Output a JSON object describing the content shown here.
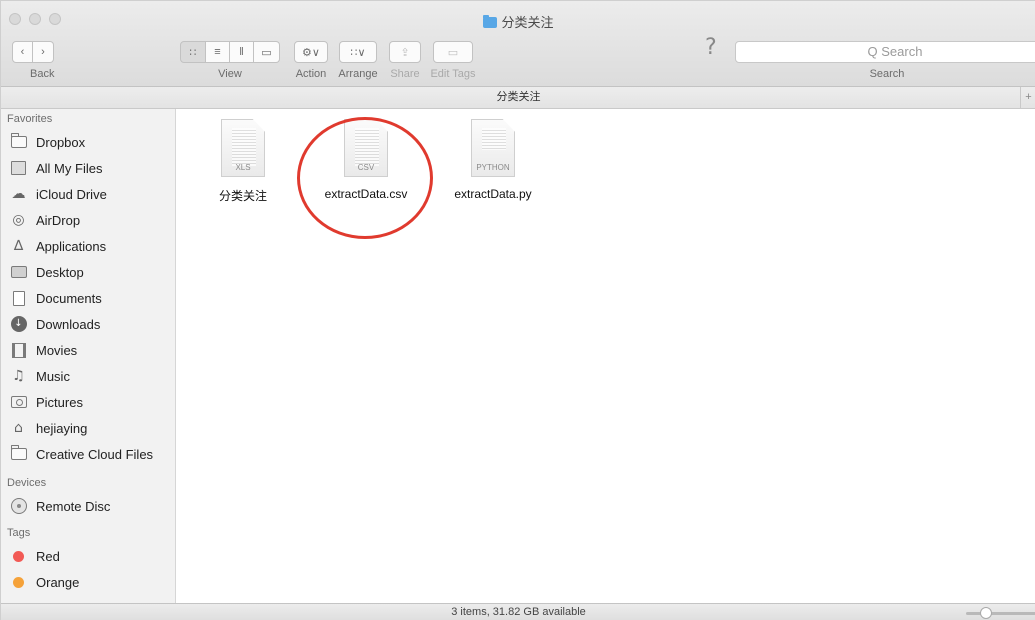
{
  "window": {
    "title": "分类关注"
  },
  "toolbar": {
    "back_label": "Back",
    "view_label": "View",
    "action_label": "Action",
    "arrange_label": "Arrange",
    "share_label": "Share",
    "edit_tags_label": "Edit Tags",
    "search_label": "Search",
    "search_placeholder": "Q Search",
    "help_glyph": "?"
  },
  "pathbar": {
    "title": "分类关注"
  },
  "sidebar": {
    "favorites_header": "Favorites",
    "favorites": [
      {
        "label": "Dropbox",
        "icon": "folder-icon"
      },
      {
        "label": "All My Files",
        "icon": "all-files-icon"
      },
      {
        "label": "iCloud Drive",
        "icon": "cloud-icon"
      },
      {
        "label": "AirDrop",
        "icon": "airdrop-icon"
      },
      {
        "label": "Applications",
        "icon": "applications-icon"
      },
      {
        "label": "Desktop",
        "icon": "desktop-icon"
      },
      {
        "label": "Documents",
        "icon": "documents-icon"
      },
      {
        "label": "Downloads",
        "icon": "downloads-icon"
      },
      {
        "label": "Movies",
        "icon": "movies-icon"
      },
      {
        "label": "Music",
        "icon": "music-icon"
      },
      {
        "label": "Pictures",
        "icon": "pictures-icon"
      },
      {
        "label": "hejiaying",
        "icon": "home-icon"
      },
      {
        "label": "Creative Cloud Files",
        "icon": "folder-icon"
      }
    ],
    "devices_header": "Devices",
    "devices": [
      {
        "label": "Remote Disc",
        "icon": "disc-icon"
      }
    ],
    "tags_header": "Tags",
    "tags": [
      {
        "label": "Red",
        "color": "#f25a55"
      },
      {
        "label": "Orange",
        "color": "#f5a23a"
      }
    ]
  },
  "files": [
    {
      "name": "分类关注",
      "ext": "XLS"
    },
    {
      "name": "extractData.csv",
      "ext": "CSV"
    },
    {
      "name": "extractData.py",
      "ext": "PYTHON"
    }
  ],
  "status": {
    "text": "3 items, 31.82 GB available"
  },
  "colors": {
    "highlight": "#e03a2e",
    "accent": "#58a7e6"
  }
}
